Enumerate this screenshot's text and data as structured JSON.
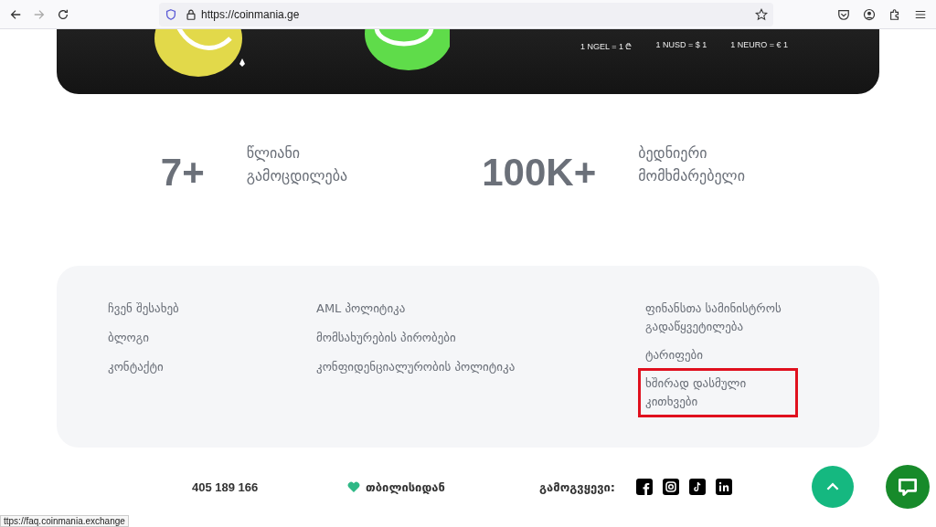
{
  "browser": {
    "url": "https://coinmania.ge",
    "status_link": "ttps://faq.coinmania.exchange"
  },
  "hero": {
    "rates": [
      "1 NGEL = 1 ₾",
      "1 NUSD = $ 1",
      "1 NEURO = € 1"
    ]
  },
  "stats": [
    {
      "value": "7+",
      "label": "წლიანი გამოცდილება"
    },
    {
      "value": "100K+",
      "label": "ბედნიერი მომხმარებელი"
    }
  ],
  "footer_links": [
    [
      {
        "text": "ჩვენ შესახებ",
        "highlighted": false
      },
      {
        "text": "ბლოგი",
        "highlighted": false
      },
      {
        "text": "კონტაქტი",
        "highlighted": false
      }
    ],
    [
      {
        "text": "AML პოლიტიკა",
        "highlighted": false
      },
      {
        "text": "მომსახურების პირობები",
        "highlighted": false
      },
      {
        "text": "კონფიდენციალურობის პოლიტიკა",
        "highlighted": false
      }
    ],
    [
      {
        "text": "ფინანსთა სამინისტროს გადაწყვეტილება",
        "highlighted": false
      },
      {
        "text": "ტარიფები",
        "highlighted": false
      },
      {
        "text": "ხშირად დასმული კითხვები",
        "highlighted": true
      }
    ]
  ],
  "bottom": {
    "phone": "405 189 166",
    "origin": "თბილისიდან",
    "follow_label": "გამოგვყევი:"
  }
}
